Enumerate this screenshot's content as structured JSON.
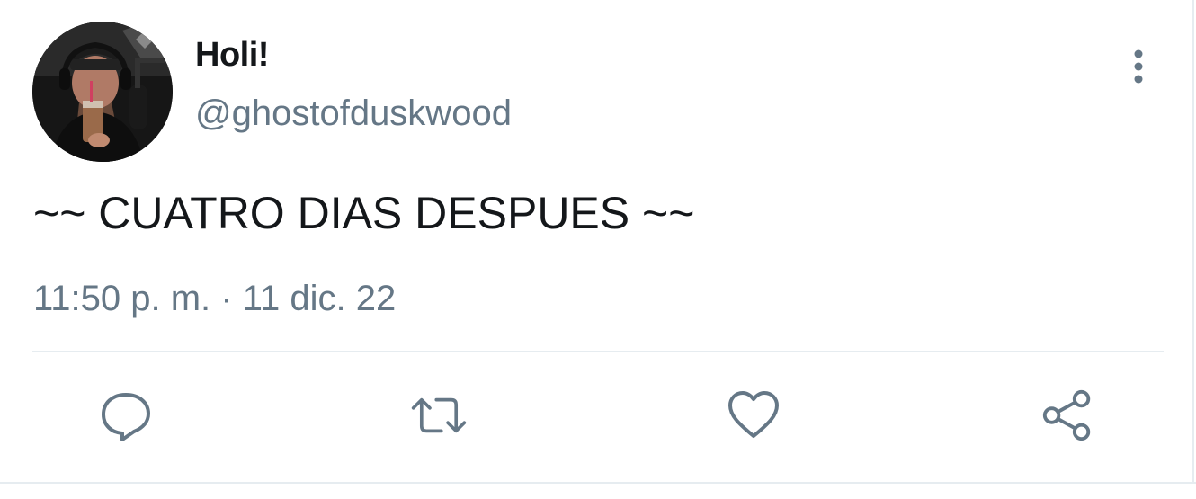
{
  "tweet": {
    "display_name": "Holi!",
    "handle": "@ghostofduskwood",
    "text": "~~ CUATRO DIAS DESPUES ~~",
    "timestamp": "11:50 p. m. · 11 dic. 22"
  },
  "actions": {
    "reply_icon": "reply-icon",
    "retweet_icon": "retweet-icon",
    "like_icon": "heart-icon",
    "share_icon": "share-icon",
    "more_icon": "more-vertical-icon"
  },
  "colors": {
    "text": "#14171a",
    "secondary": "#657786",
    "divider": "#e6ecf0",
    "icon": "#657786"
  }
}
